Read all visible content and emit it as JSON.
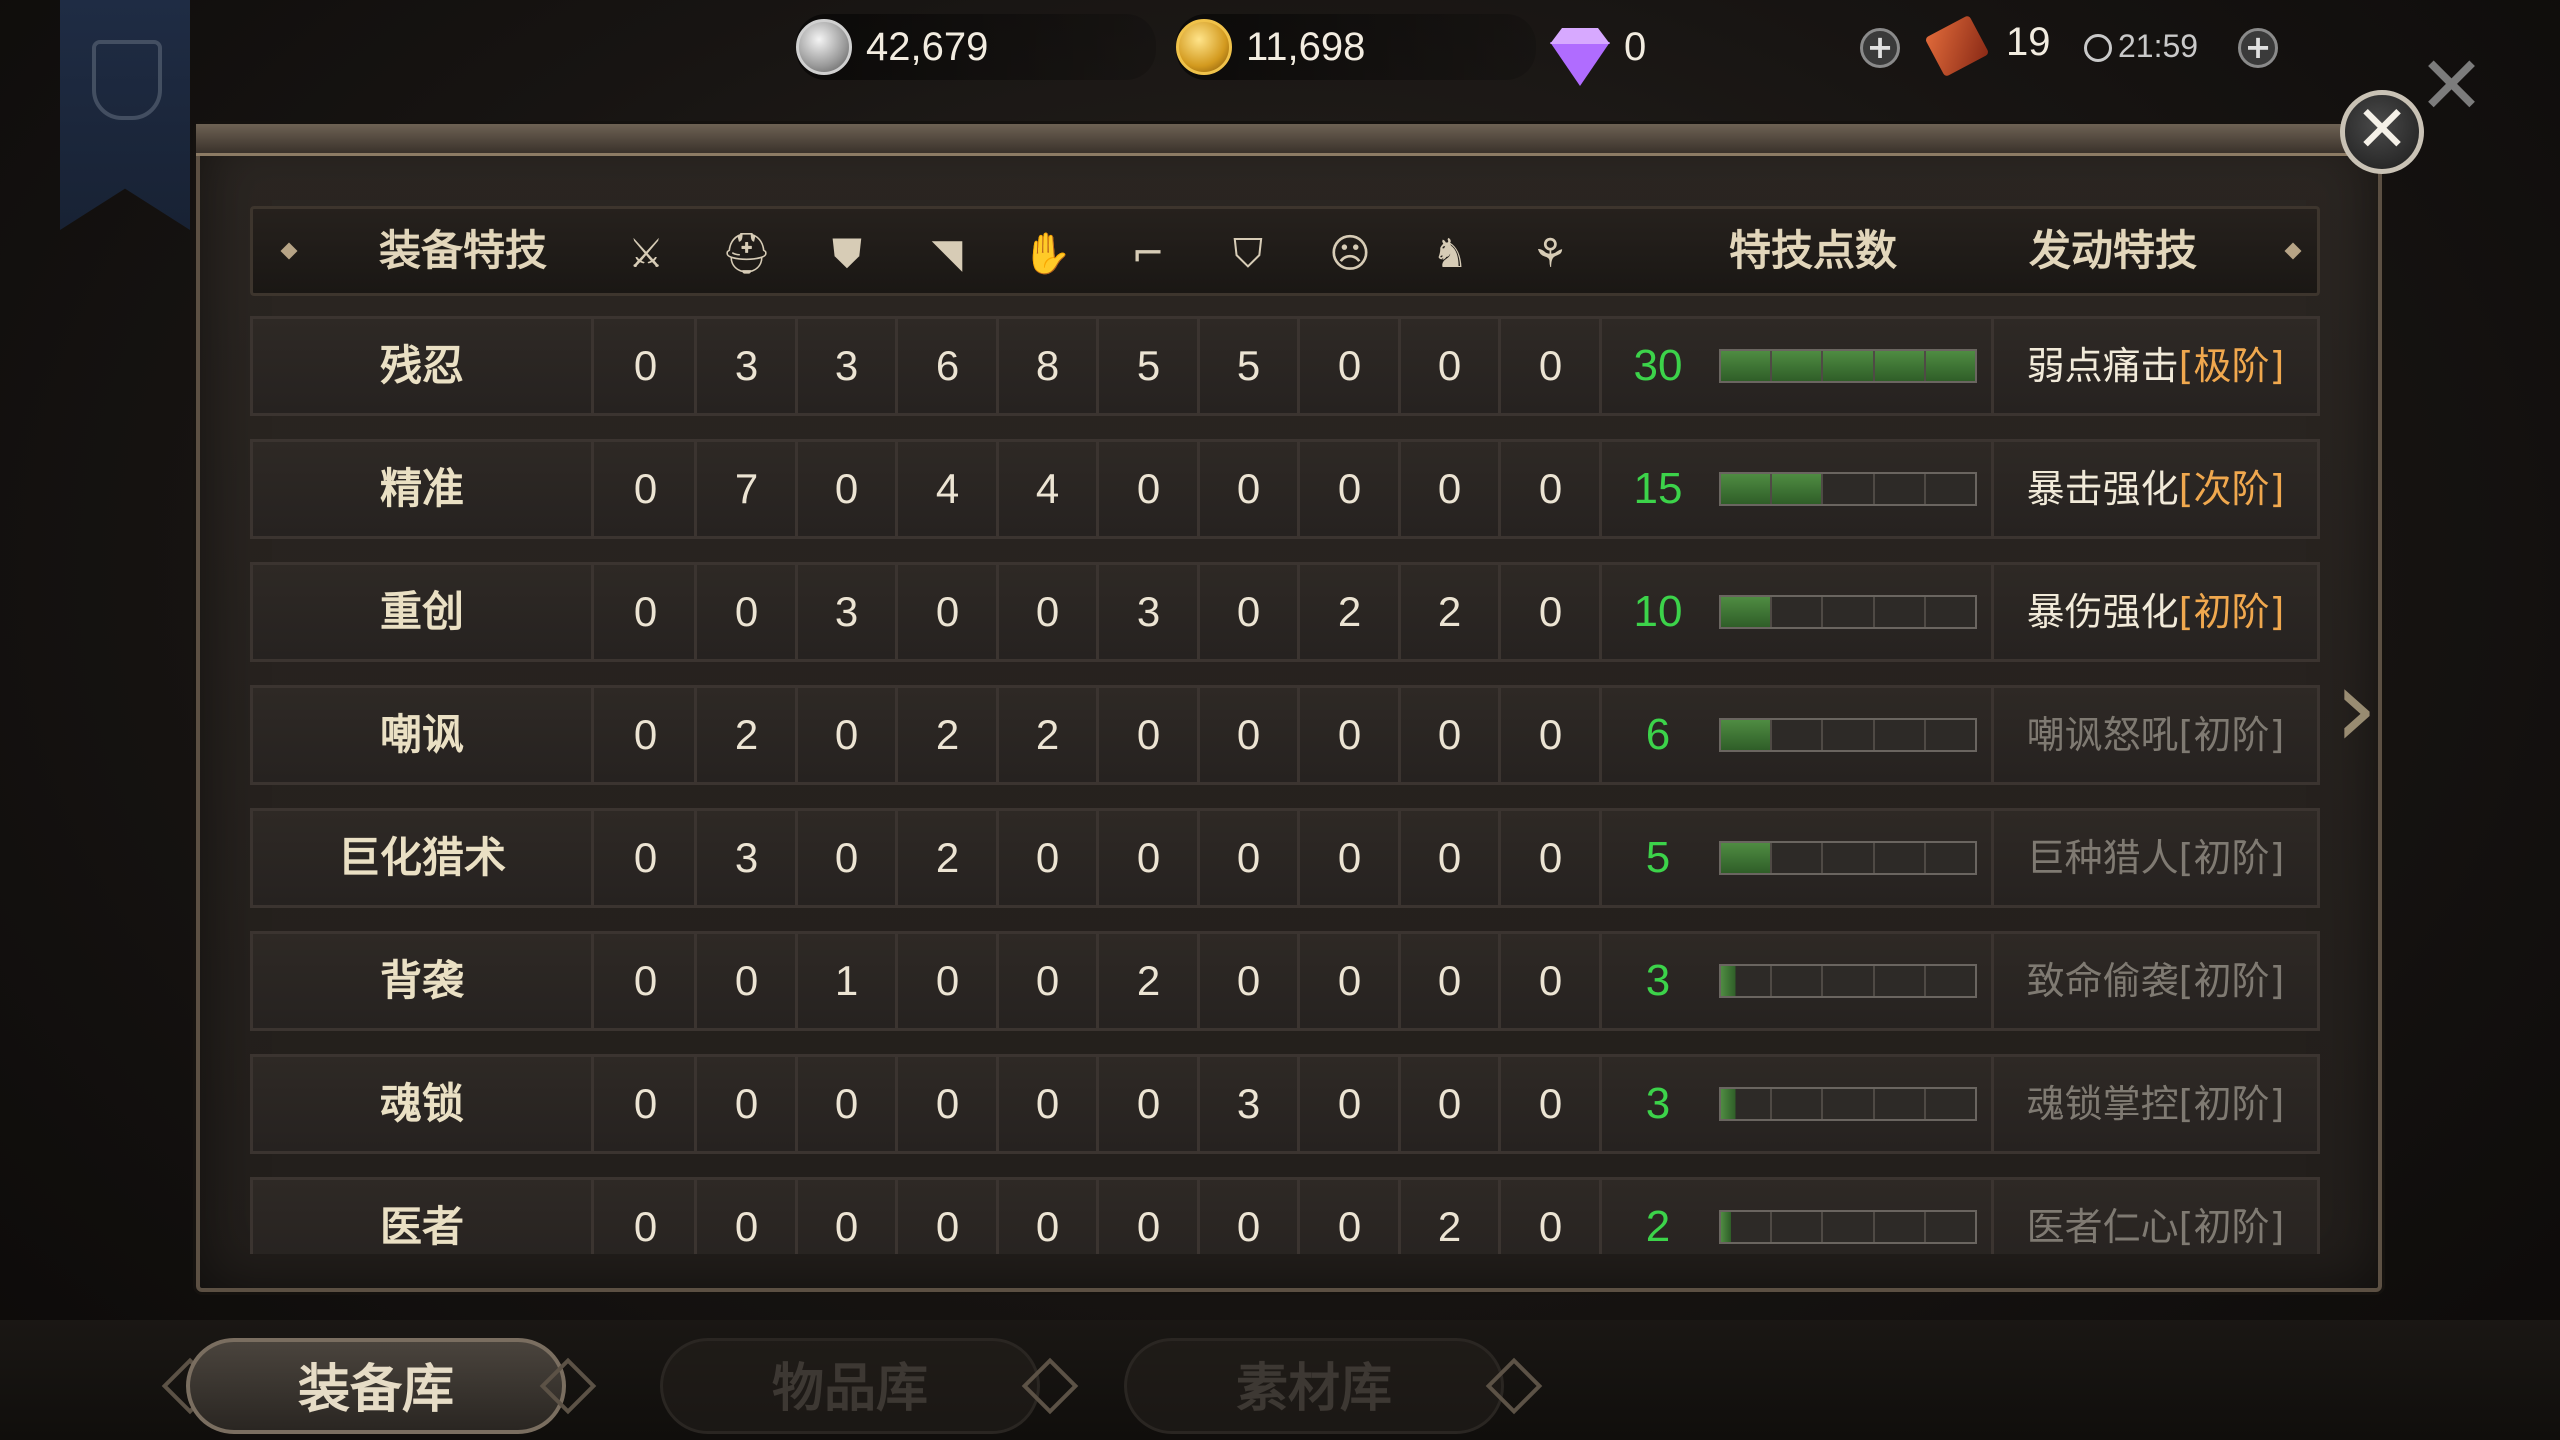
{
  "topbar": {
    "silver": "42,679",
    "gold": "11,698",
    "diamonds": "0",
    "tickets": "19",
    "timer": "21:59"
  },
  "header": {
    "col_name": "装备特技",
    "slot_icons": [
      "sword-icon",
      "helmet-icon",
      "chest-armor-icon",
      "shoulder-icon",
      "gauntlet-icon",
      "boots-icon",
      "shield-icon",
      "mask-icon",
      "horse-icon",
      "ornament-icon"
    ],
    "col_points": "特技点数",
    "col_skill": "发动特技"
  },
  "rows": [
    {
      "name": "残忍",
      "values": [
        "0",
        "3",
        "3",
        "6",
        "8",
        "5",
        "5",
        "0",
        "0",
        "0"
      ],
      "points": "30",
      "filled": 5,
      "skill": "弱点痛击",
      "tier": "[极阶]",
      "active": true
    },
    {
      "name": "精准",
      "values": [
        "0",
        "7",
        "0",
        "4",
        "4",
        "0",
        "0",
        "0",
        "0",
        "0"
      ],
      "points": "15",
      "filled": 2,
      "skill": "暴击强化",
      "tier": "[次阶]",
      "active": true
    },
    {
      "name": "重创",
      "values": [
        "0",
        "0",
        "3",
        "0",
        "0",
        "3",
        "0",
        "2",
        "2",
        "0"
      ],
      "points": "10",
      "filled": 1,
      "skill": "暴伤强化",
      "tier": "[初阶]",
      "active": true
    },
    {
      "name": "嘲讽",
      "values": [
        "0",
        "2",
        "0",
        "2",
        "2",
        "0",
        "0",
        "0",
        "0",
        "0"
      ],
      "points": "6",
      "filled": 1,
      "skill": "嘲讽怒吼",
      "tier": "[初阶]",
      "active": false
    },
    {
      "name": "巨化猎术",
      "values": [
        "0",
        "3",
        "0",
        "2",
        "0",
        "0",
        "0",
        "0",
        "0",
        "0"
      ],
      "points": "5",
      "filled": 1,
      "skill": "巨种猎人",
      "tier": "[初阶]",
      "active": false
    },
    {
      "name": "背袭",
      "values": [
        "0",
        "0",
        "1",
        "0",
        "0",
        "2",
        "0",
        "0",
        "0",
        "0"
      ],
      "points": "3",
      "filled": 0.3,
      "skill": "致命偷袭",
      "tier": "[初阶]",
      "active": false
    },
    {
      "name": "魂锁",
      "values": [
        "0",
        "0",
        "0",
        "0",
        "0",
        "0",
        "3",
        "0",
        "0",
        "0"
      ],
      "points": "3",
      "filled": 0.3,
      "skill": "魂锁掌控",
      "tier": "[初阶]",
      "active": false
    },
    {
      "name": "医者",
      "values": [
        "0",
        "0",
        "0",
        "0",
        "0",
        "0",
        "0",
        "0",
        "2",
        "0"
      ],
      "points": "2",
      "filled": 0.2,
      "skill": "医者仁心",
      "tier": "[初阶]",
      "active": false
    }
  ],
  "tabs": [
    {
      "label": "装备库",
      "active": true
    },
    {
      "label": "物品库",
      "active": false
    },
    {
      "label": "素材库",
      "active": false
    }
  ],
  "colors": {
    "points_green": "#3cd34a",
    "tier_orange": "#f0a84e",
    "bar_green": "#4f8c42"
  }
}
